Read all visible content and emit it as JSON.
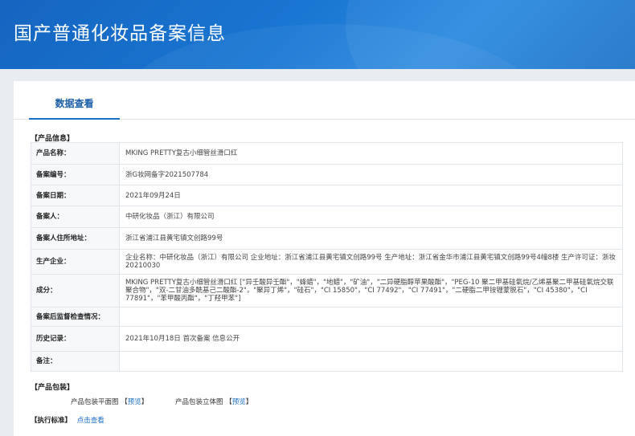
{
  "header": {
    "title": "国产普通化妆品备案信息"
  },
  "tabs": [
    {
      "label": "数据查看"
    }
  ],
  "product_section": {
    "title": "【产品信息】",
    "rows": [
      {
        "label": "产品名称：",
        "value": "MKING PRETTY复古小细管丝滑口红"
      },
      {
        "label": "备案编号：",
        "value": "浙G妆网备字2021507784"
      },
      {
        "label": "备案日期：",
        "value": "2021年09月24日"
      },
      {
        "label": "备案人：",
        "value": "中研化妆品（浙江）有限公司"
      },
      {
        "label": "备案人住所地址：",
        "value": "浙江省浦江县黄宅镇文创路99号"
      },
      {
        "label": "生产企业：",
        "value": "企业名称：中研化妆品（浙江）有限公司 企业地址：浙江省浦江县黄宅镇文创路99号 生产地址：浙江省金华市浦江县黄宅镇文创路99号4幢8楼 生产许可证：浙妆20210030"
      },
      {
        "label": "成分：",
        "value": "MKING PRETTY复古小细管丝滑口红 [\"异壬酸异壬酯\"，\"蜂蜡\"，\"地蜡\"，\"矿油\"，\"二异硬脂醇苹果酸酯\"，\"PEG-10 聚二甲基硅氧烷/乙烯基聚二甲基硅氧烷交联聚合物\"，\"双-二甘油多酰基己二酸酯-2\"，\"聚异丁烯\"，\"硅石\"，\"CI 15850\"，\"CI 77492\"，\"CI 77491\"，\"二硬脂二甲铵锂蒙脱石\"，\"CI 45380\"，\"CI 77891\"，\"苯甲酸丙酯\"，\"丁羟甲苯\"]"
      },
      {
        "label": "备案后监督检查情况：",
        "value": ""
      },
      {
        "label": "历史记录：",
        "value": "2021年10月18日 首次备案 信息公开"
      },
      {
        "label": "备注：",
        "value": ""
      }
    ]
  },
  "package_section": {
    "title": "【产品包装】",
    "flat_label": "产品包装平面图",
    "flat_link": "预览",
    "solid_label": "产品包装立体图",
    "solid_link": "预览",
    "bracket_open": "【",
    "bracket_close": "】"
  },
  "standard_section": {
    "title": "【执行标准】",
    "link": "点击查看"
  }
}
